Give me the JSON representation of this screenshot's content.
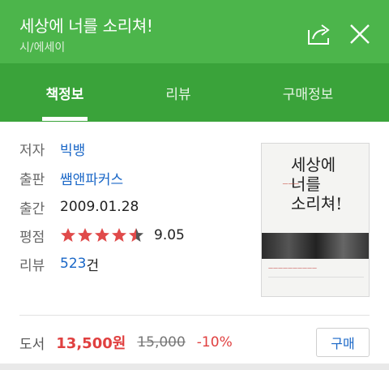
{
  "header": {
    "title": "세상에 너를 소리쳐!",
    "category": "시/에세이"
  },
  "tabs": [
    "책정보",
    "리뷰",
    "구매정보"
  ],
  "details": {
    "author_label": "저자",
    "author": "빅뱅",
    "publisher_label": "출판",
    "publisher": "쌤앤파커스",
    "date_label": "출간",
    "date": "2009.01.28",
    "rating_label": "평점",
    "rating": "9.05",
    "rating_stars": 4.5,
    "review_label": "리뷰",
    "review_count": "523",
    "review_unit": "건"
  },
  "cover": {
    "title_line1": "세상에",
    "title_line2": "너를",
    "title_line3": "소리쳐!"
  },
  "purchase": {
    "type_label": "도서",
    "price": "13,500원",
    "original_price": "15,000",
    "discount": "-10%",
    "buy_label": "구매"
  },
  "colors": {
    "header_green": "#4cb54b",
    "tab_green": "#3aa33a",
    "link_blue": "#1a67c7",
    "price_red": "#e04040"
  }
}
